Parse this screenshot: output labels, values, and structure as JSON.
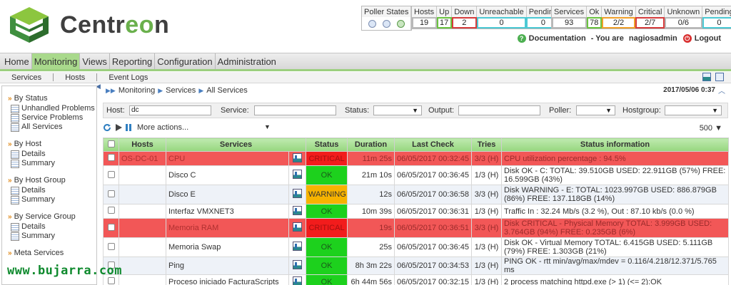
{
  "brand": {
    "name_a": "Centr",
    "name_b": "eo",
    "name_c": "n"
  },
  "poller": {
    "label": "Poller States"
  },
  "hosts_stats": {
    "headers": [
      "Hosts",
      "Up",
      "Down",
      "Unreachable",
      "Pending"
    ],
    "values": [
      "19",
      "17",
      "2",
      "0",
      "0"
    ]
  },
  "services_stats": {
    "headers": [
      "Services",
      "Ok",
      "Warning",
      "Critical",
      "Unknown",
      "Pending"
    ],
    "values": [
      "93",
      "78",
      "2/2",
      "2/7",
      "0/6",
      "0"
    ]
  },
  "userline": {
    "documentation": "Documentation",
    "separator": " - You are ",
    "user": "nagiosadmin",
    "logout": "Logout"
  },
  "mainmenu": [
    "Home",
    "Monitoring",
    "Views",
    "Reporting",
    "Configuration",
    "Administration"
  ],
  "submenu": [
    "Services",
    "Hosts",
    "Event Logs"
  ],
  "leftnav": {
    "by_status": "By Status",
    "status_items": [
      "Unhandled Problems",
      "Service Problems",
      "All Services"
    ],
    "by_host": "By Host",
    "host_items": [
      "Details",
      "Summary"
    ],
    "by_host_group": "By Host Group",
    "hostgroup_items": [
      "Details",
      "Summary"
    ],
    "by_service_group": "By Service Group",
    "servicegroup_items": [
      "Details",
      "Summary"
    ],
    "meta_services": "Meta Services"
  },
  "breadcrumb": [
    "Monitoring",
    "Services",
    "All Services"
  ],
  "datetime": "2017/05/06 0:37",
  "filters": {
    "host_label": "Host:",
    "host_value": "dc",
    "service_label": "Service:",
    "status_label": "Status:",
    "output_label": "Output:",
    "poller_label": "Poller:",
    "hostgroup_label": "Hostgroup:"
  },
  "actions": {
    "more_actions": "More actions...",
    "per_page": "500"
  },
  "table": {
    "headers": [
      "Hosts",
      "Services",
      "Status",
      "Duration",
      "Last Check",
      "Tries",
      "Status information"
    ],
    "rows": [
      {
        "host": "OS-DC-01",
        "service": "CPU",
        "status": "CRITICAL",
        "duration": "11m 25s",
        "last_check": "06/05/2017 00:32:45",
        "tries": "3/3 (H)",
        "info": "CPU utilization percentage : 94.5%"
      },
      {
        "host": "",
        "service": "Disco C",
        "status": "OK",
        "duration": "21m 10s",
        "last_check": "06/05/2017 00:36:45",
        "tries": "1/3 (H)",
        "info": "Disk OK - C: TOTAL: 39.510GB USED: 22.911GB (57%) FREE: 16.599GB (43%)"
      },
      {
        "host": "",
        "service": "Disco E",
        "status": "WARNING",
        "duration": "12s",
        "last_check": "06/05/2017 00:36:58",
        "tries": "3/3 (H)",
        "info": "Disk WARNING - E: TOTAL: 1023.997GB USED: 886.879GB (86%) FREE: 137.118GB (14%)"
      },
      {
        "host": "",
        "service": "Interfaz VMXNET3",
        "status": "OK",
        "duration": "10m 39s",
        "last_check": "06/05/2017 00:36:31",
        "tries": "1/3 (H)",
        "info": "Traffic In : 32.24 Mb/s (3.2 %), Out : 87.10 kb/s (0.0 %)"
      },
      {
        "host": "",
        "service": "Memoria RAM",
        "status": "CRITICAL",
        "duration": "19s",
        "last_check": "06/05/2017 00:36:51",
        "tries": "3/3 (H)",
        "info": "Disk CRITICAL - Physical Memory TOTAL: 3.999GB USED: 3.764GB (94%) FREE: 0.235GB (6%)"
      },
      {
        "host": "",
        "service": "Memoria Swap",
        "status": "OK",
        "duration": "25s",
        "last_check": "06/05/2017 00:36:45",
        "tries": "1/3 (H)",
        "info": "Disk OK - Virtual Memory TOTAL: 6.415GB USED: 5.111GB (79%) FREE: 1.303GB (21%)"
      },
      {
        "host": "",
        "service": "Ping",
        "status": "OK",
        "duration": "8h 3m 22s",
        "last_check": "06/05/2017 00:34:53",
        "tries": "1/3 (H)",
        "info": "PING OK - rtt min/avg/max/mdev = 0.116/4.218/12.371/5.765 ms"
      },
      {
        "host": "",
        "service": "Proceso iniciado FacturaScripts",
        "status": "OK",
        "duration": "6h 44m 56s",
        "last_check": "06/05/2017 00:32:15",
        "tries": "1/3 (H)",
        "info": "2 process matching httpd.exe (> 1) (<= 2):OK"
      }
    ]
  },
  "watermark": "www.bujarra.com",
  "colors": {
    "ok": "#1dd11d",
    "warning": "#f7b300",
    "critical": "#f21c1c",
    "accent": "#6ab04c"
  }
}
